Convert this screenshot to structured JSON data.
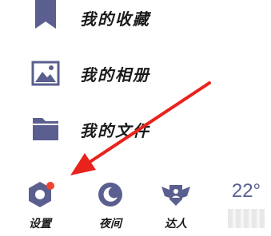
{
  "menu": {
    "items": [
      {
        "label": "我的收藏",
        "icon": "bookmark-icon"
      },
      {
        "label": "我的相册",
        "icon": "image-icon"
      },
      {
        "label": "我的文件",
        "icon": "folder-icon"
      }
    ]
  },
  "bottom_bar": {
    "settings_label": "设置",
    "night_label": "夜间",
    "expert_label": "达人",
    "weather_temp": "22°"
  },
  "colors": {
    "icon": "#5a5f8f",
    "notification_dot": "#f0442f",
    "arrow": "#e8231d"
  }
}
